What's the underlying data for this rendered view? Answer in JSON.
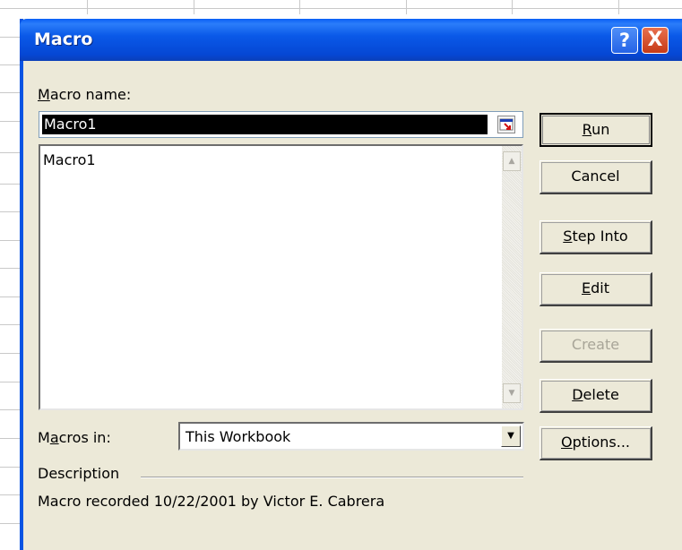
{
  "window": {
    "title": "Macro",
    "help_label": "?",
    "close_label": "X"
  },
  "macro_name": {
    "label_mnemonic": "M",
    "label_rest": "acro name:",
    "value": "Macro1"
  },
  "macro_list": {
    "items": [
      "Macro1"
    ]
  },
  "macros_in": {
    "label_pre": "M",
    "label_mnemonic": "a",
    "label_rest": "cros in:",
    "selected": "This Workbook"
  },
  "description": {
    "heading": "Description",
    "text": "Macro recorded 10/22/2001 by Victor E. Cabrera"
  },
  "buttons": {
    "run": {
      "mnemonic": "R",
      "rest": "un"
    },
    "cancel": {
      "label": "Cancel"
    },
    "step_into": {
      "mnemonic": "S",
      "rest": "tep Into"
    },
    "edit": {
      "mnemonic": "E",
      "rest": "dit"
    },
    "create": {
      "label": "Create"
    },
    "delete": {
      "mnemonic": "D",
      "rest": "elete"
    },
    "options": {
      "mnemonic": "O",
      "rest": "ptions..."
    }
  },
  "colors": {
    "titlebar": "#0a59e8",
    "dialog_bg": "#ece9d8",
    "selection": "#000000"
  }
}
